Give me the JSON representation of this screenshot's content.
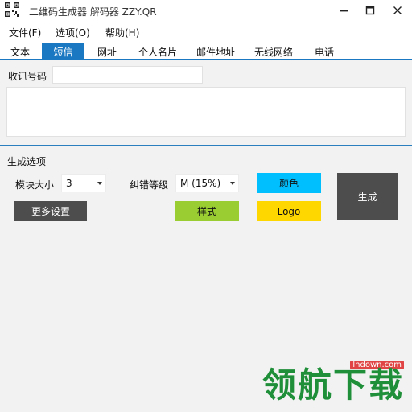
{
  "window": {
    "title": "二维码生成器 解码器 ZZY.QR",
    "icons": {
      "app": "qr-code-icon",
      "minimize": "minimize-icon",
      "maximize": "maximize-icon",
      "close": "close-icon"
    }
  },
  "menu": [
    {
      "label": "文件(F)"
    },
    {
      "label": "选项(O)"
    },
    {
      "label": "帮助(H)"
    }
  ],
  "tabs": [
    {
      "label": "文本",
      "active": false
    },
    {
      "label": "短信",
      "active": true
    },
    {
      "label": "网址",
      "active": false
    },
    {
      "label": "个人名片",
      "active": false
    },
    {
      "label": "邮件地址",
      "active": false
    },
    {
      "label": "无线网络",
      "active": false
    },
    {
      "label": "电话",
      "active": false
    }
  ],
  "sms": {
    "number_label": "收讯号码",
    "number_value": "",
    "message_value": ""
  },
  "options": {
    "section_title": "生成选项",
    "module_size_label": "模块大小",
    "module_size_value": "3",
    "error_level_label": "纠错等级",
    "error_level_value": "M (15%)",
    "more_settings_label": "更多设置",
    "style_label": "样式",
    "color_label": "颜色",
    "logo_label": "Logo",
    "generate_label": "生成"
  },
  "colors": {
    "accent": "#1a78c2",
    "color_button": "#00bfff",
    "style_button": "#9acd32",
    "logo_button": "#ffd700",
    "dark_button": "#4d4d4d"
  },
  "watermark": {
    "text": "领航下载",
    "url": "lhdown.com"
  }
}
